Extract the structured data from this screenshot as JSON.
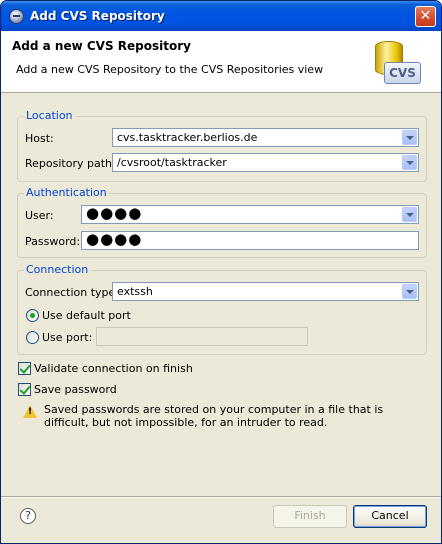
{
  "window": {
    "title": "Add CVS Repository",
    "close_glyph": "✕"
  },
  "banner": {
    "title": "Add a new CVS Repository",
    "description": "Add a new CVS Repository to the CVS Repositories view",
    "icon_text": "CVS"
  },
  "location": {
    "legend": "Location",
    "host_label": "Host:",
    "host_value": "cvs.tasktracker.berlios.de",
    "path_label": "Repository path:",
    "path_value": "/cvsroot/tasktracker"
  },
  "authentication": {
    "legend": "Authentication",
    "user_label": "User:",
    "user_value": "●●●●",
    "password_label": "Password:",
    "password_value": "●●●●"
  },
  "connection": {
    "legend": "Connection",
    "type_label": "Connection type:",
    "type_value": "extssh",
    "default_port_label": "Use default port",
    "use_port_label": "Use port:",
    "port_value": ""
  },
  "options": {
    "validate_label": "Validate connection on finish",
    "save_password_label": "Save password",
    "warning_text": "Saved passwords are stored on your computer in a file that is difficult, but not impossible, for an intruder to read."
  },
  "footer": {
    "help_glyph": "?",
    "finish_label": "Finish",
    "cancel_label": "Cancel"
  },
  "colors": {
    "title_bar": "#0054e3",
    "legend": "#0046d5",
    "dialog_bg": "#ece9d8"
  }
}
